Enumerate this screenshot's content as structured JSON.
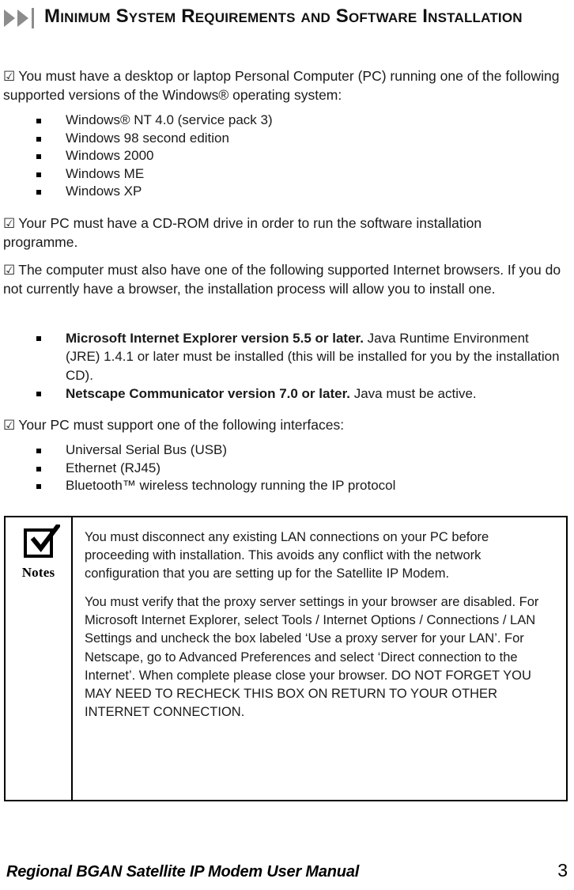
{
  "heading": {
    "icon": "double-right-arrow-icon",
    "text": "Minimum System Requirements and Software Installation"
  },
  "checkbox_glyph": "☑",
  "paragraphs": {
    "os_intro": "You must have a desktop or laptop Personal Computer (PC) running one of the following supported versions of the Windows® operating system:",
    "cdrom": "Your PC must have a CD-ROM drive in order to run the software installation programme.",
    "browsers_intro": "The computer must also have one of the following supported Internet browsers. If you do not currently have a browser, the installation process will allow you to install one.",
    "interfaces_intro": "Your PC must support one of the following interfaces:"
  },
  "os_list": [
    "Windows® NT 4.0 (service pack 3)",
    "Windows 98 second edition",
    "Windows 2000",
    "Windows ME",
    "Windows XP"
  ],
  "browser_list": [
    {
      "bold": "Microsoft Internet Explorer version 5.5 or later.",
      "rest": " Java Runtime Environment (JRE) 1.4.1 or later must be installed (this will be installed for you by the installation CD)."
    },
    {
      "bold": "Netscape Communicator version 7.0 or later.",
      "rest": " Java must be active."
    }
  ],
  "interface_list": [
    "Universal Serial Bus (USB)",
    "Ethernet (RJ45)",
    "Bluetooth™ wireless technology running the IP protocol"
  ],
  "notes_box": {
    "icon": "checked-box-icon",
    "label": "Notes",
    "paragraphs": [
      "You must disconnect any existing LAN connections on your PC before proceeding with installation. This avoids any conflict with the network configuration that you are setting up for the Satellite IP Modem.",
      "You must verify that the proxy server settings in your browser are disabled. For Microsoft Internet Explorer, select Tools / Internet Options / Connections / LAN Settings and uncheck the box labeled ‘Use a proxy server for your LAN’. For Netscape, go to Advanced Preferences and select ‘Direct connection to the Internet’. When complete please close your browser.  DO NOT FORGET YOU MAY NEED TO RECHECK THIS BOX ON RETURN TO YOUR OTHER INTERNET CONNECTION."
    ]
  },
  "footer": {
    "title": "Regional BGAN Satellite IP Modem User Manual",
    "page_number": "3"
  },
  "colors": {
    "text": "#1a1a1a",
    "icon_gray": "#8c8c8c",
    "rule": "#000000"
  }
}
